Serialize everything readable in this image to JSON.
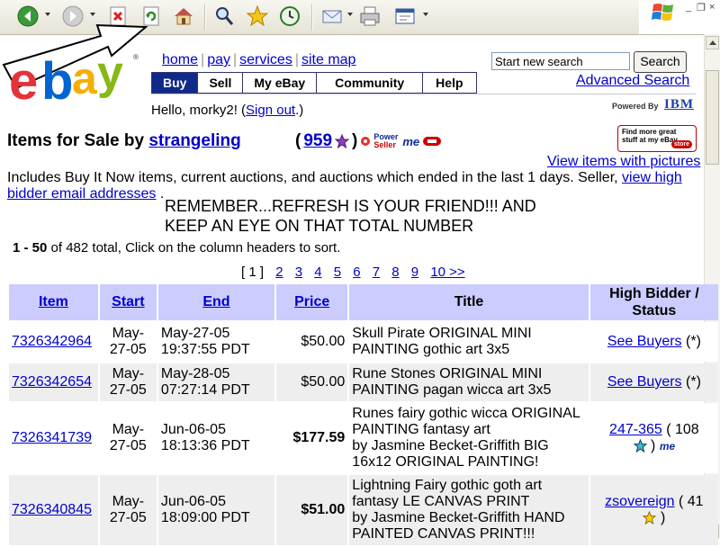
{
  "browser": {
    "toolbar_buttons": [
      {
        "name": "back-icon"
      },
      {
        "name": "forward-icon"
      },
      {
        "name": "stop-icon"
      },
      {
        "name": "refresh-icon"
      },
      {
        "name": "home-icon"
      },
      {
        "name": "search-icon"
      },
      {
        "name": "favorites-icon"
      },
      {
        "name": "history-icon"
      },
      {
        "name": "mail-icon"
      },
      {
        "name": "print-icon"
      },
      {
        "name": "edit-icon"
      }
    ],
    "window_controls": [
      "_",
      "❐",
      "×"
    ]
  },
  "header": {
    "logo": "ebay",
    "links": [
      "home",
      "pay",
      "services",
      "site map"
    ],
    "tabs": [
      "Buy",
      "Sell",
      "My eBay",
      "Community",
      "Help"
    ],
    "search_value": "Start new search",
    "search_button": "Search",
    "advanced_search": "Advanced Search",
    "powered_by": "Powered By",
    "sponsor": "IBM",
    "hello_prefix": "Hello, morky2! (",
    "sign_out": "Sign out",
    "hello_suffix": ".)"
  },
  "listing": {
    "title_prefix": "Items for Sale by",
    "seller": "strangeling",
    "feedback_open": "(",
    "feedback_score": "959",
    "feedback_close": ")",
    "power_seller_line1": "Power",
    "power_seller_line2": "Seller",
    "me_badge": "me",
    "store_badge_text": "Find more great stuff at my eBay",
    "store_badge_label": "store",
    "view_pictures": "View items with pictures",
    "includes_text": "Includes Buy It Now items, current auctions, and auctions which ended in the last 1 days. Seller,",
    "high_bidder_link": "view high bidder email addresses",
    "includes_end": ".",
    "remember_text": "REMEMBER...REFRESH IS YOUR FRIEND!!!  AND KEEP AN EYE ON THAT TOTAL NUMBER",
    "count_range": "1 - 50",
    "count_rest": "of 482 total, Click on the column headers to sort.",
    "pager_current": "[ 1 ]",
    "pager_pages": [
      "2",
      "3",
      "4",
      "5",
      "6",
      "7",
      "8",
      "9",
      "10 >>"
    ]
  },
  "table": {
    "headers": [
      "Item",
      "Start",
      "End",
      "Price",
      "Title",
      "High Bidder / Status"
    ],
    "rows": [
      {
        "item": "7326342964",
        "start": "May-27-05",
        "end_date": "May-27-05",
        "end_time": "19:37:55 PDT",
        "price": "$50.00",
        "title": "Skull Pirate ORIGINAL MINI PAINTING gothic art 3x5",
        "bidder": "See Buyers",
        "bidder_extra": "(*)"
      },
      {
        "item": "7326342654",
        "start": "May-27-05",
        "end_date": "May-28-05",
        "end_time": "07:27:14 PDT",
        "price": "$50.00",
        "title": "Rune Stones ORIGINAL MINI PAINTING pagan wicca art 3x5",
        "bidder": "See Buyers",
        "bidder_extra": "(*)"
      },
      {
        "item": "7326341739",
        "start": "May-27-05",
        "end_date": "Jun-06-05",
        "end_time": "18:13:36 PDT",
        "price": "$177.59",
        "title": "Runes fairy gothic wicca ORIGINAL PAINTING fantasy art",
        "title2": "by Jasmine Becket-Griffith BIG 16x12 ORIGINAL PAINTING!",
        "bidder": "247-365",
        "bidder_extra": "( 108",
        "bidder_close": ")"
      },
      {
        "item": "7326340845",
        "start": "May-27-05",
        "end_date": "Jun-06-05",
        "end_time": "18:09:00 PDT",
        "price": "$51.00",
        "title": "Lightning Fairy gothic goth art fantasy LE CANVAS PRINT",
        "title2": "by Jasmine Becket-Griffith HAND PAINTED CANVAS PRINT!!!",
        "bidder": "zsovereign",
        "bidder_extra": "( 41",
        "bidder_close": ")"
      }
    ]
  },
  "colors": {
    "link": "#0000cc",
    "table_header": "#ccccff",
    "row_alt": "#eeeeee",
    "nav_active": "#0f2a8a"
  }
}
